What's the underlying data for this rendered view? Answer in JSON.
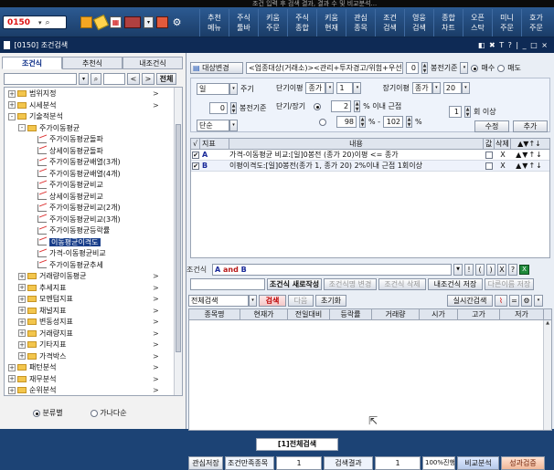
{
  "topstrip": "조건 입력 후 검색 결과, 결과 수 및 비교분석...",
  "toolbar": {
    "screen_no": "0150",
    "buttons": [
      {
        "l1": "추천",
        "l2": "메뉴"
      },
      {
        "l1": "주식",
        "l2": "툴바"
      },
      {
        "l1": "키움",
        "l2": "주문"
      },
      {
        "l1": "주식",
        "l2": "종합"
      },
      {
        "l1": "키움",
        "l2": "현재"
      },
      {
        "l1": "관심",
        "l2": "종목"
      },
      {
        "l1": "조건",
        "l2": "검색"
      },
      {
        "l1": "영웅",
        "l2": "검색"
      },
      {
        "l1": "종합",
        "l2": "차트"
      },
      {
        "l1": "오픈",
        "l2": "스탁"
      },
      {
        "l1": "미니",
        "l2": "주문"
      },
      {
        "l1": "호가",
        "l2": "주문"
      }
    ]
  },
  "window": {
    "title": "[0150] 조건검색",
    "icons": "◧ ✖ T ? | _ □ ×"
  },
  "left": {
    "tabs": [
      "조건식",
      "추천식",
      "내조건식"
    ],
    "search_btn": "전체",
    "tree": [
      {
        "level": 0,
        "type": "folder",
        "toggle": "+",
        "label": "범위지정",
        "arrow": ">"
      },
      {
        "level": 0,
        "type": "folder",
        "toggle": "+",
        "label": "시세분석",
        "arrow": ">"
      },
      {
        "level": 0,
        "type": "folder",
        "toggle": "-",
        "label": "기술적분석",
        "arrow": ""
      },
      {
        "level": 1,
        "type": "folder",
        "toggle": "-",
        "label": "주가이동평균",
        "arrow": ""
      },
      {
        "level": 2,
        "type": "leaf",
        "label": "주가이동평균돌파",
        "arrow": ""
      },
      {
        "level": 2,
        "type": "leaf",
        "label": "상세이동평균돌파",
        "arrow": ""
      },
      {
        "level": 2,
        "type": "leaf",
        "label": "주가이동평균배열(3개)",
        "arrow": ""
      },
      {
        "level": 2,
        "type": "leaf",
        "label": "주가이동평균배열(4개)",
        "arrow": ""
      },
      {
        "level": 2,
        "type": "leaf",
        "label": "주가이동평균비교",
        "arrow": ""
      },
      {
        "level": 2,
        "type": "leaf",
        "label": "상세이동평균비교",
        "arrow": ""
      },
      {
        "level": 2,
        "type": "leaf",
        "label": "주가이동평균비교(2개)",
        "arrow": ""
      },
      {
        "level": 2,
        "type": "leaf",
        "label": "주가이동평균비교(3개)",
        "arrow": ""
      },
      {
        "level": 2,
        "type": "leaf",
        "label": "주가이동평균등락률",
        "arrow": ""
      },
      {
        "level": 2,
        "type": "leaf",
        "label": "이동평균이격도",
        "arrow": "",
        "selected": true
      },
      {
        "level": 2,
        "type": "leaf",
        "label": "가격-이동평균비교",
        "arrow": ""
      },
      {
        "level": 2,
        "type": "leaf",
        "label": "주가이동평균추세",
        "arrow": ""
      },
      {
        "level": 1,
        "type": "folder",
        "toggle": "+",
        "label": "거래량이동평균",
        "arrow": ">"
      },
      {
        "level": 1,
        "type": "folder",
        "toggle": "+",
        "label": "추세지표",
        "arrow": ">"
      },
      {
        "level": 1,
        "type": "folder",
        "toggle": "+",
        "label": "모멘텀지표",
        "arrow": ">"
      },
      {
        "level": 1,
        "type": "folder",
        "toggle": "+",
        "label": "채널지표",
        "arrow": ">"
      },
      {
        "level": 1,
        "type": "folder",
        "toggle": "+",
        "label": "변동성지표",
        "arrow": ">"
      },
      {
        "level": 1,
        "type": "folder",
        "toggle": "+",
        "label": "거래량지표",
        "arrow": ">"
      },
      {
        "level": 1,
        "type": "folder",
        "toggle": "+",
        "label": "기타지표",
        "arrow": ">"
      },
      {
        "level": 1,
        "type": "folder",
        "toggle": "+",
        "label": "가격박스",
        "arrow": ">"
      },
      {
        "level": 0,
        "type": "folder",
        "toggle": "+",
        "label": "패턴분석",
        "arrow": ">"
      },
      {
        "level": 0,
        "type": "folder",
        "toggle": "+",
        "label": "재무분석",
        "arrow": ">"
      },
      {
        "level": 0,
        "type": "folder",
        "toggle": "+",
        "label": "순위분석",
        "arrow": ">"
      }
    ],
    "bottom": {
      "opt1": "분류별",
      "opt2": "가나다순"
    }
  },
  "right": {
    "top": {
      "change_btn": "대상변경",
      "target_text": "<업종대상(거래소)><관리+투자경고/위험+우선",
      "bong_value": "0",
      "bong_label": "봉전기준",
      "buy_label": "매수",
      "sell_label": "매도"
    },
    "params": {
      "period": "일",
      "period_label": "주기",
      "bong2_value": "0",
      "bong2_label": "봉전기준",
      "unit": "단순",
      "short_label": "단기이평",
      "short_type": "종가",
      "short_val": "1",
      "long_label": "장기이평",
      "long_type": "종가",
      "long_val": "20",
      "ratio_label": "단기/장기",
      "r1_val": "2",
      "r1_label": "% 이내 근접",
      "r2_from": "98",
      "r2_mid": "% -",
      "r2_to": "102",
      "r2_unit": "%",
      "times_val": "1",
      "times_label": "회 이상",
      "edit_btn": "수정",
      "add_btn": "추가"
    },
    "cond_table": {
      "headers": [
        "√",
        "지표",
        "내용",
        "값",
        "삭제",
        "▲▼↑↓"
      ],
      "rows": [
        {
          "id": "A",
          "text": "가격-이동평균 비교:[일]0봉전 (종가 20)이평 <= 종가",
          "del": "X",
          "move": "▲▼↑↓"
        },
        {
          "id": "B",
          "text": "이평이격도:[일]0봉전(종가 1, 종가 20) 2%이내 근접 1회이상",
          "del": "X",
          "move": "▲▼↑↓"
        }
      ]
    },
    "expr": {
      "label": "조건식",
      "a": "A",
      "and": "and",
      "b": "B",
      "ops": [
        "▼",
        "!",
        "(",
        ")",
        "X",
        "?"
      ],
      "btns": [
        "조건식 새로작성",
        "조건식명 변경",
        "조건식 삭제",
        "내조건식 저장",
        "다른이름 저장"
      ]
    },
    "results": {
      "scope": "전체검색",
      "search_btn": "검색",
      "next_btn": "다음",
      "reset_btn": "초기화",
      "realtime_btn": "실시간검색",
      "headers": [
        "종목명",
        "현재가",
        "전일대비",
        "등락률",
        "거래량",
        "시가",
        "고가",
        "저가"
      ]
    },
    "bottom": {
      "tab": "[1]전체검색",
      "save": "관심저장",
      "count_label": "조건만족종목",
      "count_val": "1",
      "result_label": "검색결과",
      "result_val": "1",
      "progress": "100%진행",
      "compare": "비교분석",
      "verify": "성과검증"
    }
  }
}
